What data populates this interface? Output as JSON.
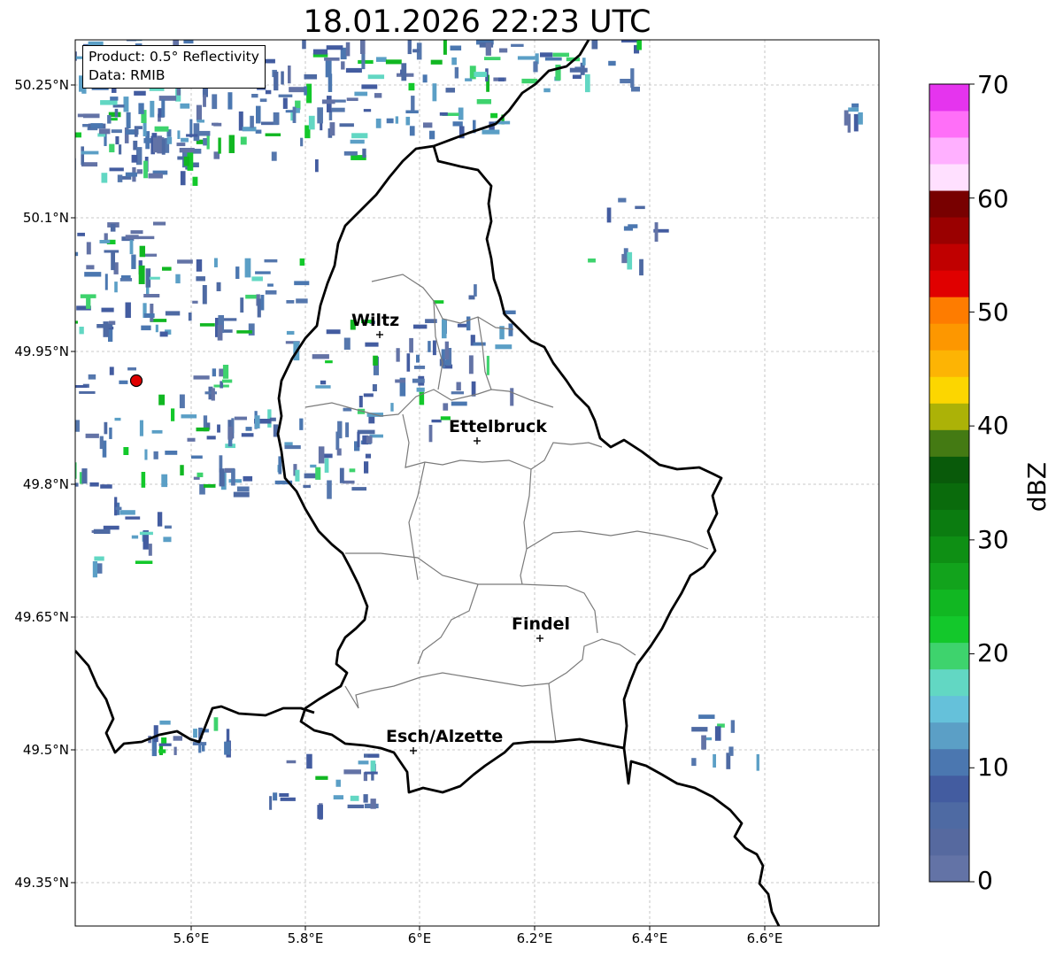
{
  "title": "18.01.2026 22:23 UTC",
  "info": {
    "product": "Product: 0.5° Reflectivity",
    "data": "Data: RMIB"
  },
  "latitude_labels": [
    "50.25°N",
    "50.1°N",
    "49.95°N",
    "49.8°N",
    "49.65°N",
    "49.5°N",
    "49.35°N"
  ],
  "longitude_labels": [
    "5.6°E",
    "5.8°E",
    "6°E",
    "6.2°E",
    "6.4°E",
    "6.6°E"
  ],
  "cities": [
    {
      "name": "Wiltz"
    },
    {
      "name": "Ettelbruck"
    },
    {
      "name": "Findel"
    },
    {
      "name": "Esch/Alzette"
    }
  ],
  "colorbar": {
    "label": "dBZ",
    "ticks": [
      "70",
      "60",
      "50",
      "40",
      "30",
      "20",
      "10",
      "0"
    ],
    "colors": [
      "#6373a6",
      "#56699f",
      "#4e6aa3",
      "#435ca0",
      "#4b77b0",
      "#5b9fc6",
      "#65c1da",
      "#62d7c3",
      "#3ed36d",
      "#13c82b",
      "#11b722",
      "#12a31c",
      "#0e8f14",
      "#0b7c10",
      "#0a6b0c",
      "#095a0a",
      "#447a13",
      "#acb207",
      "#fcd600",
      "#fdb404",
      "#fd9700",
      "#fe7c00",
      "#e00000",
      "#c00000",
      "#9a0000",
      "#780000",
      "#ffe0ff",
      "#ffb0ff",
      "#ff6ff8",
      "#e534ee"
    ]
  },
  "radar_marker": "red-circle-radar-site",
  "map_extent": {
    "lon_min": 5.4,
    "lon_max": 6.8,
    "lat_min": 49.3,
    "lat_max": 50.3
  }
}
